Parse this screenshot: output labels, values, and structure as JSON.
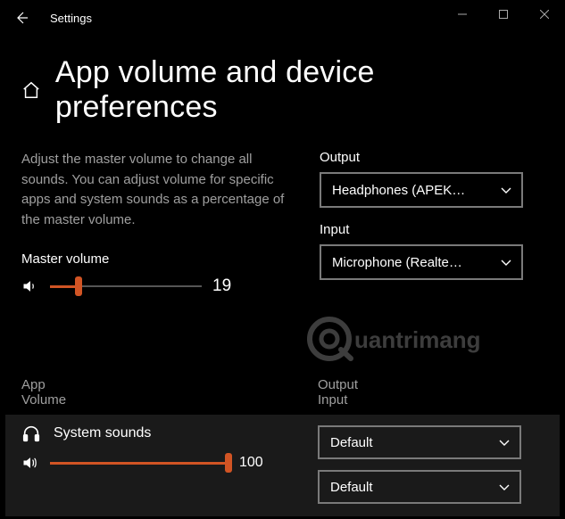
{
  "window": {
    "title": "Settings"
  },
  "page": {
    "title": "App volume and device preferences",
    "description": "Adjust the master volume to change all sounds. You can adjust volume for specific apps and system sounds as a percentage of the master volume."
  },
  "master": {
    "label": "Master volume",
    "value": 19,
    "value_text": "19"
  },
  "output": {
    "label": "Output",
    "selected": "Headphones (APEK…"
  },
  "input": {
    "label": "Input",
    "selected": "Microphone (Realte…"
  },
  "columns": {
    "app": "App",
    "volume": "Volume",
    "output": "Output",
    "input": "Input"
  },
  "apps": [
    {
      "name": "System sounds",
      "volume": 100,
      "volume_text": "100",
      "output": "Default",
      "input": "Default"
    }
  ],
  "watermark": "Quantrimang"
}
